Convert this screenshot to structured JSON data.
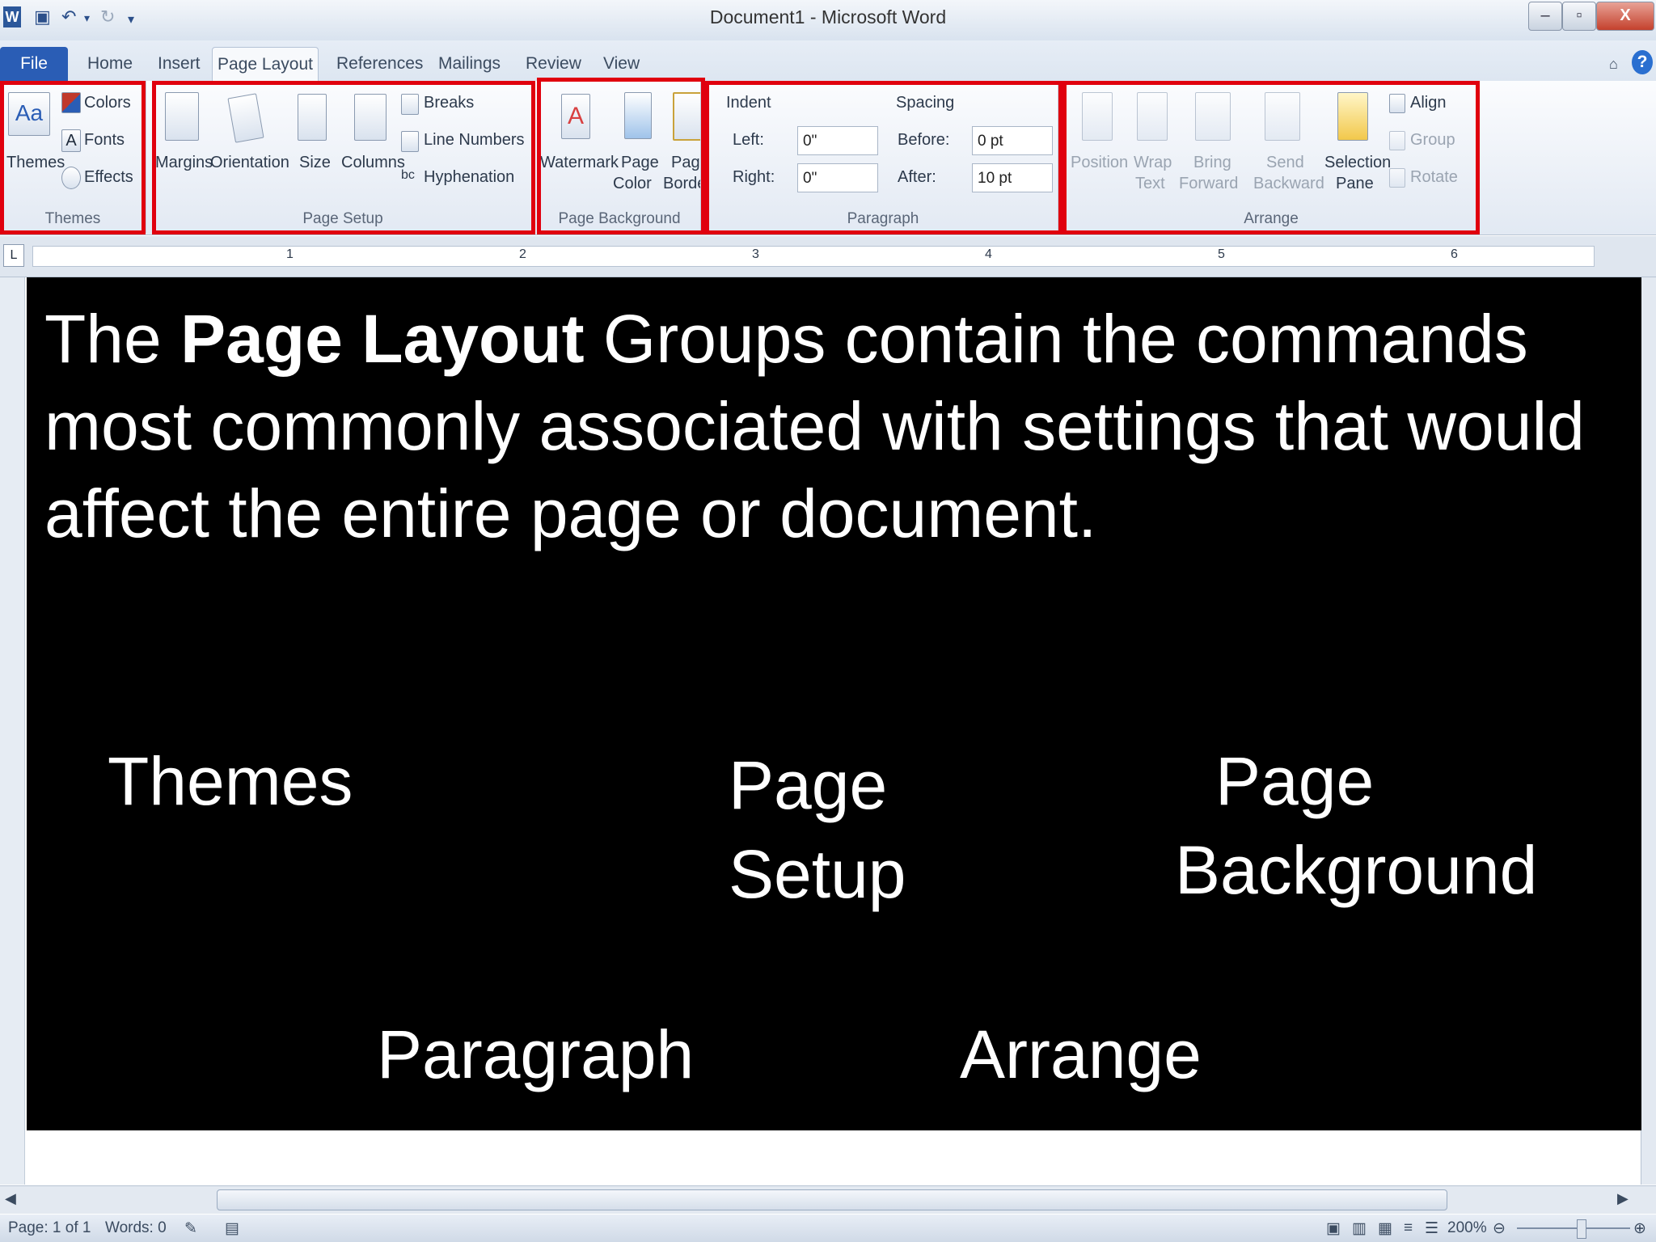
{
  "window": {
    "title": "Document1  -  Microsoft Word",
    "minimize": "–",
    "restore": "▫",
    "close": "X"
  },
  "tabs": [
    "File",
    "Home",
    "Insert",
    "Page Layout",
    "References",
    "Mailings",
    "Review",
    "View"
  ],
  "ribbon": {
    "themes": {
      "label": "Themes",
      "themes_button": "Themes",
      "colors": "Colors",
      "fonts": "Fonts",
      "effects": "Effects"
    },
    "page_setup": {
      "label": "Page Setup",
      "margins": "Margins",
      "orientation": "Orientation",
      "size": "Size",
      "columns": "Columns",
      "breaks": "Breaks",
      "line_numbers": "Line Numbers",
      "hyphenation": "Hyphenation"
    },
    "page_background": {
      "label": "Page Background",
      "watermark": "Watermark",
      "page_color_1": "Page",
      "page_color_2": "Color",
      "page_borders_1": "Page",
      "page_borders_2": "Borders"
    },
    "paragraph": {
      "label": "Paragraph",
      "indent": "Indent",
      "left_label": "Left:",
      "left_value": "0\"",
      "right_label": "Right:",
      "right_value": "0\"",
      "spacing": "Spacing",
      "before_label": "Before:",
      "before_value": "0 pt",
      "after_label": "After:",
      "after_value": "10 pt"
    },
    "arrange": {
      "label": "Arrange",
      "position": "Position",
      "wrap_1": "Wrap",
      "wrap_2": "Text",
      "bring_1": "Bring",
      "bring_2": "Forward",
      "send_1": "Send",
      "send_2": "Backward",
      "selection_1": "Selection",
      "selection_2": "Pane",
      "align": "Align",
      "group": "Group",
      "rotate": "Rotate"
    }
  },
  "ruler_numbers": [
    "1",
    "2",
    "3",
    "4",
    "5",
    "6"
  ],
  "slide": {
    "intro_pre": "The ",
    "intro_bold": "Page Layout",
    "intro_post": " Groups contain the commands most commonly associated with settings that would affect the entire page or document.",
    "themes": "Themes",
    "page_setup_1": "Page",
    "page_setup_2": "Setup",
    "page_background_1": "Page",
    "page_background_2": "Background",
    "paragraph": "Paragraph",
    "arrange": "Arrange"
  },
  "status": {
    "page": "Page: 1 of 1",
    "words": "Words: 0",
    "zoom": "200%"
  },
  "colors": {
    "highlight": "#e0000e",
    "file_tab": "#2a5db5"
  }
}
